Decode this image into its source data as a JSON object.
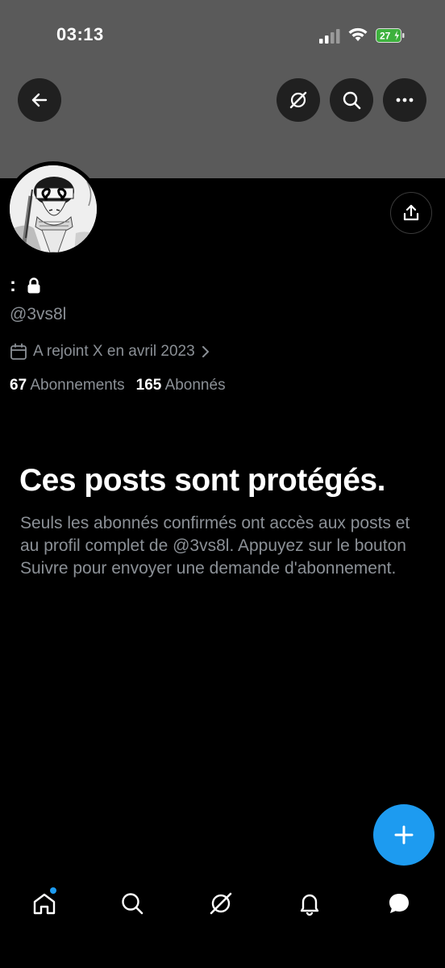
{
  "status_bar": {
    "time": "03:13",
    "battery": "27"
  },
  "header": {
    "back_icon": "arrow-left-icon",
    "grok_icon": "grok-icon",
    "search_icon": "search-icon",
    "more_icon": "more-horizontal-icon"
  },
  "profile": {
    "display_name": ":",
    "handle": "@3vs8l",
    "joined": "A rejoint X en avril 2023",
    "following_count": "67",
    "following_label": "Abonnements",
    "followers_count": "165",
    "followers_label": "Abonnés"
  },
  "protected": {
    "title": "Ces posts sont protégés.",
    "description": "Seuls les abonnés confirmés ont accès aux posts et au profil complet de @3vs8l. Appuyez sur le bouton Suivre pour envoyer une demande d'abonnement."
  },
  "tab_bar": {
    "items": [
      "home-icon",
      "search-icon",
      "grok-icon",
      "bell-icon",
      "messages-icon"
    ]
  },
  "colors": {
    "accent": "#1d9bf0",
    "banner": "#5a5a5a",
    "muted": "#8b9096"
  }
}
